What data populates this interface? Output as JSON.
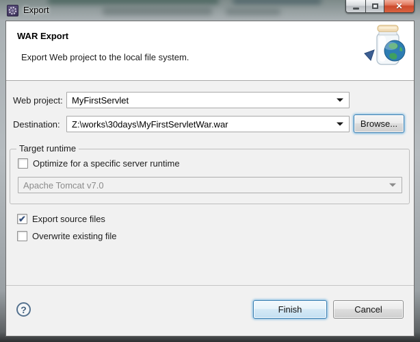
{
  "window": {
    "title": "Export",
    "controls": {
      "minimize": "minimize",
      "maximize": "maximize",
      "close": "✕"
    }
  },
  "header": {
    "title": "WAR Export",
    "description": "Export Web project to the local file system.",
    "icon": "war-jar-globe-icon"
  },
  "form": {
    "web_project": {
      "label": "Web project:",
      "value": "MyFirstServlet"
    },
    "destination": {
      "label": "Destination:",
      "value": "Z:\\works\\30days\\MyFirstServletWar.war"
    },
    "browse_label": "Browse..."
  },
  "target_runtime": {
    "group_label": "Target runtime",
    "optimize": {
      "label": "Optimize for a specific server runtime",
      "checked": false,
      "check": ""
    },
    "runtime": {
      "value": "Apache Tomcat v7.0",
      "enabled": false
    }
  },
  "options": [
    {
      "label": "Export source files",
      "checked": true,
      "check": "✔"
    },
    {
      "label": "Overwrite existing file",
      "checked": false,
      "check": ""
    }
  ],
  "footer": {
    "help": "?",
    "finish_label": "Finish",
    "cancel_label": "Cancel"
  },
  "colors": {
    "close_button_red": "#cc4a2c",
    "focus_ring_blue": "#3c7fb1",
    "check_blue": "#39537e",
    "disabled_text": "#8b8b8b",
    "content_background": "#f1f1f1",
    "header_background": "#ffffff",
    "title_icon_purple": "#3a3157"
  }
}
